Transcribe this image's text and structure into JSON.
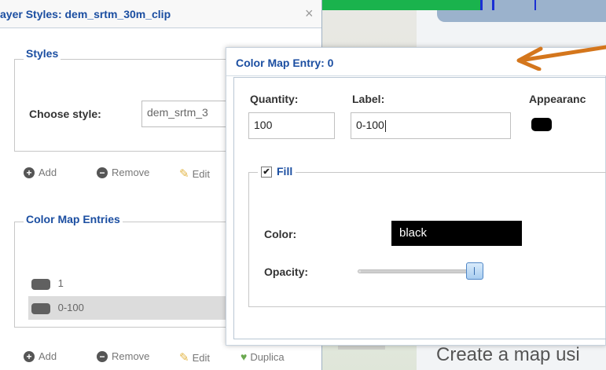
{
  "layer_panel": {
    "title": "ayer Styles: dem_srtm_30m_clip",
    "close_glyph": "×",
    "styles_section": {
      "legend": "Styles",
      "choose_label": "Choose style:",
      "choose_value": "dem_srtm_3"
    },
    "toolbar_top": {
      "add": "Add",
      "remove": "Remove",
      "edit": "Edit"
    },
    "color_map_section": {
      "legend": "Color Map Entries",
      "entries": [
        {
          "label": "1",
          "swatch_color": "#606060"
        },
        {
          "label": "0-100",
          "swatch_color": "#606060"
        }
      ]
    },
    "toolbar_bottom": {
      "add": "Add",
      "remove": "Remove",
      "edit": "Edit",
      "duplicate": "Duplica"
    }
  },
  "dialog": {
    "title": "Color Map Entry: 0",
    "quantity_label": "Quantity:",
    "quantity_value": "100",
    "label_label": "Label:",
    "label_value": "0-100",
    "appearance_label": "Appearanc",
    "appearance_color": "#000000",
    "fill": {
      "legend": "Fill",
      "checked": true,
      "color_label": "Color:",
      "color_value": "black",
      "opacity_label": "Opacity:",
      "opacity_level": 1.0
    }
  },
  "background": {
    "create_map_text": "Create a map usi"
  },
  "colors": {
    "accent_blue": "#1b4ea1",
    "annotation_arrow": "#d4761c"
  }
}
